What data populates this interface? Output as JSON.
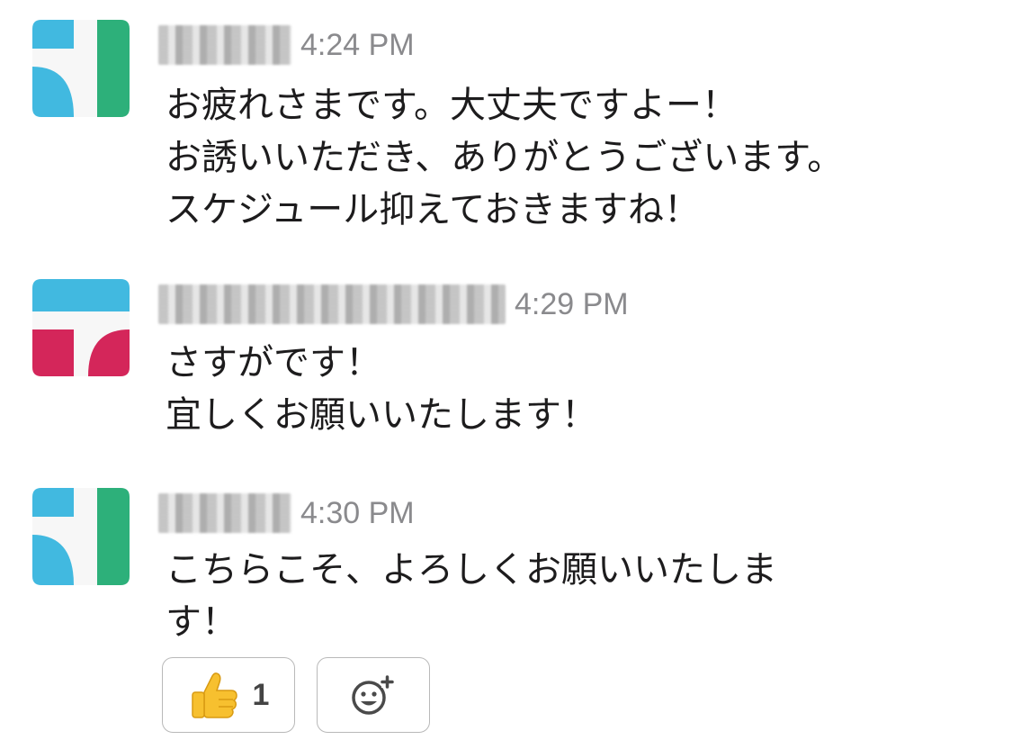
{
  "colors": {
    "avatar_blue": "#41b9e0",
    "avatar_green": "#2db07a",
    "avatar_red": "#d4265a",
    "timestamp": "#8a8a8d",
    "text": "#1d1c1d",
    "reaction_border": "#b9b9b9"
  },
  "messages": [
    {
      "avatar_icon": "blue-green-tile-icon",
      "sender": "",
      "timestamp": "4:24 PM",
      "text": "お疲れさまです。大丈夫ですよー！\nお誘いいただき、ありがとうございます。\nスケジュール抑えておきますね！"
    },
    {
      "avatar_icon": "blue-red-tile-icon",
      "sender": "",
      "timestamp": "4:29 PM",
      "text": "さすがです！\n宜しくお願いいたします！"
    },
    {
      "avatar_icon": "blue-green-tile-icon",
      "sender": "",
      "timestamp": "4:30 PM",
      "text": "こちらこそ、よろしくお願いいたしま\nす！"
    }
  ],
  "reactions": [
    {
      "emoji": "👍",
      "icon": "thumbs-up-emoji-icon",
      "count": "1"
    }
  ],
  "add_reaction_icon": "add-reaction-icon"
}
